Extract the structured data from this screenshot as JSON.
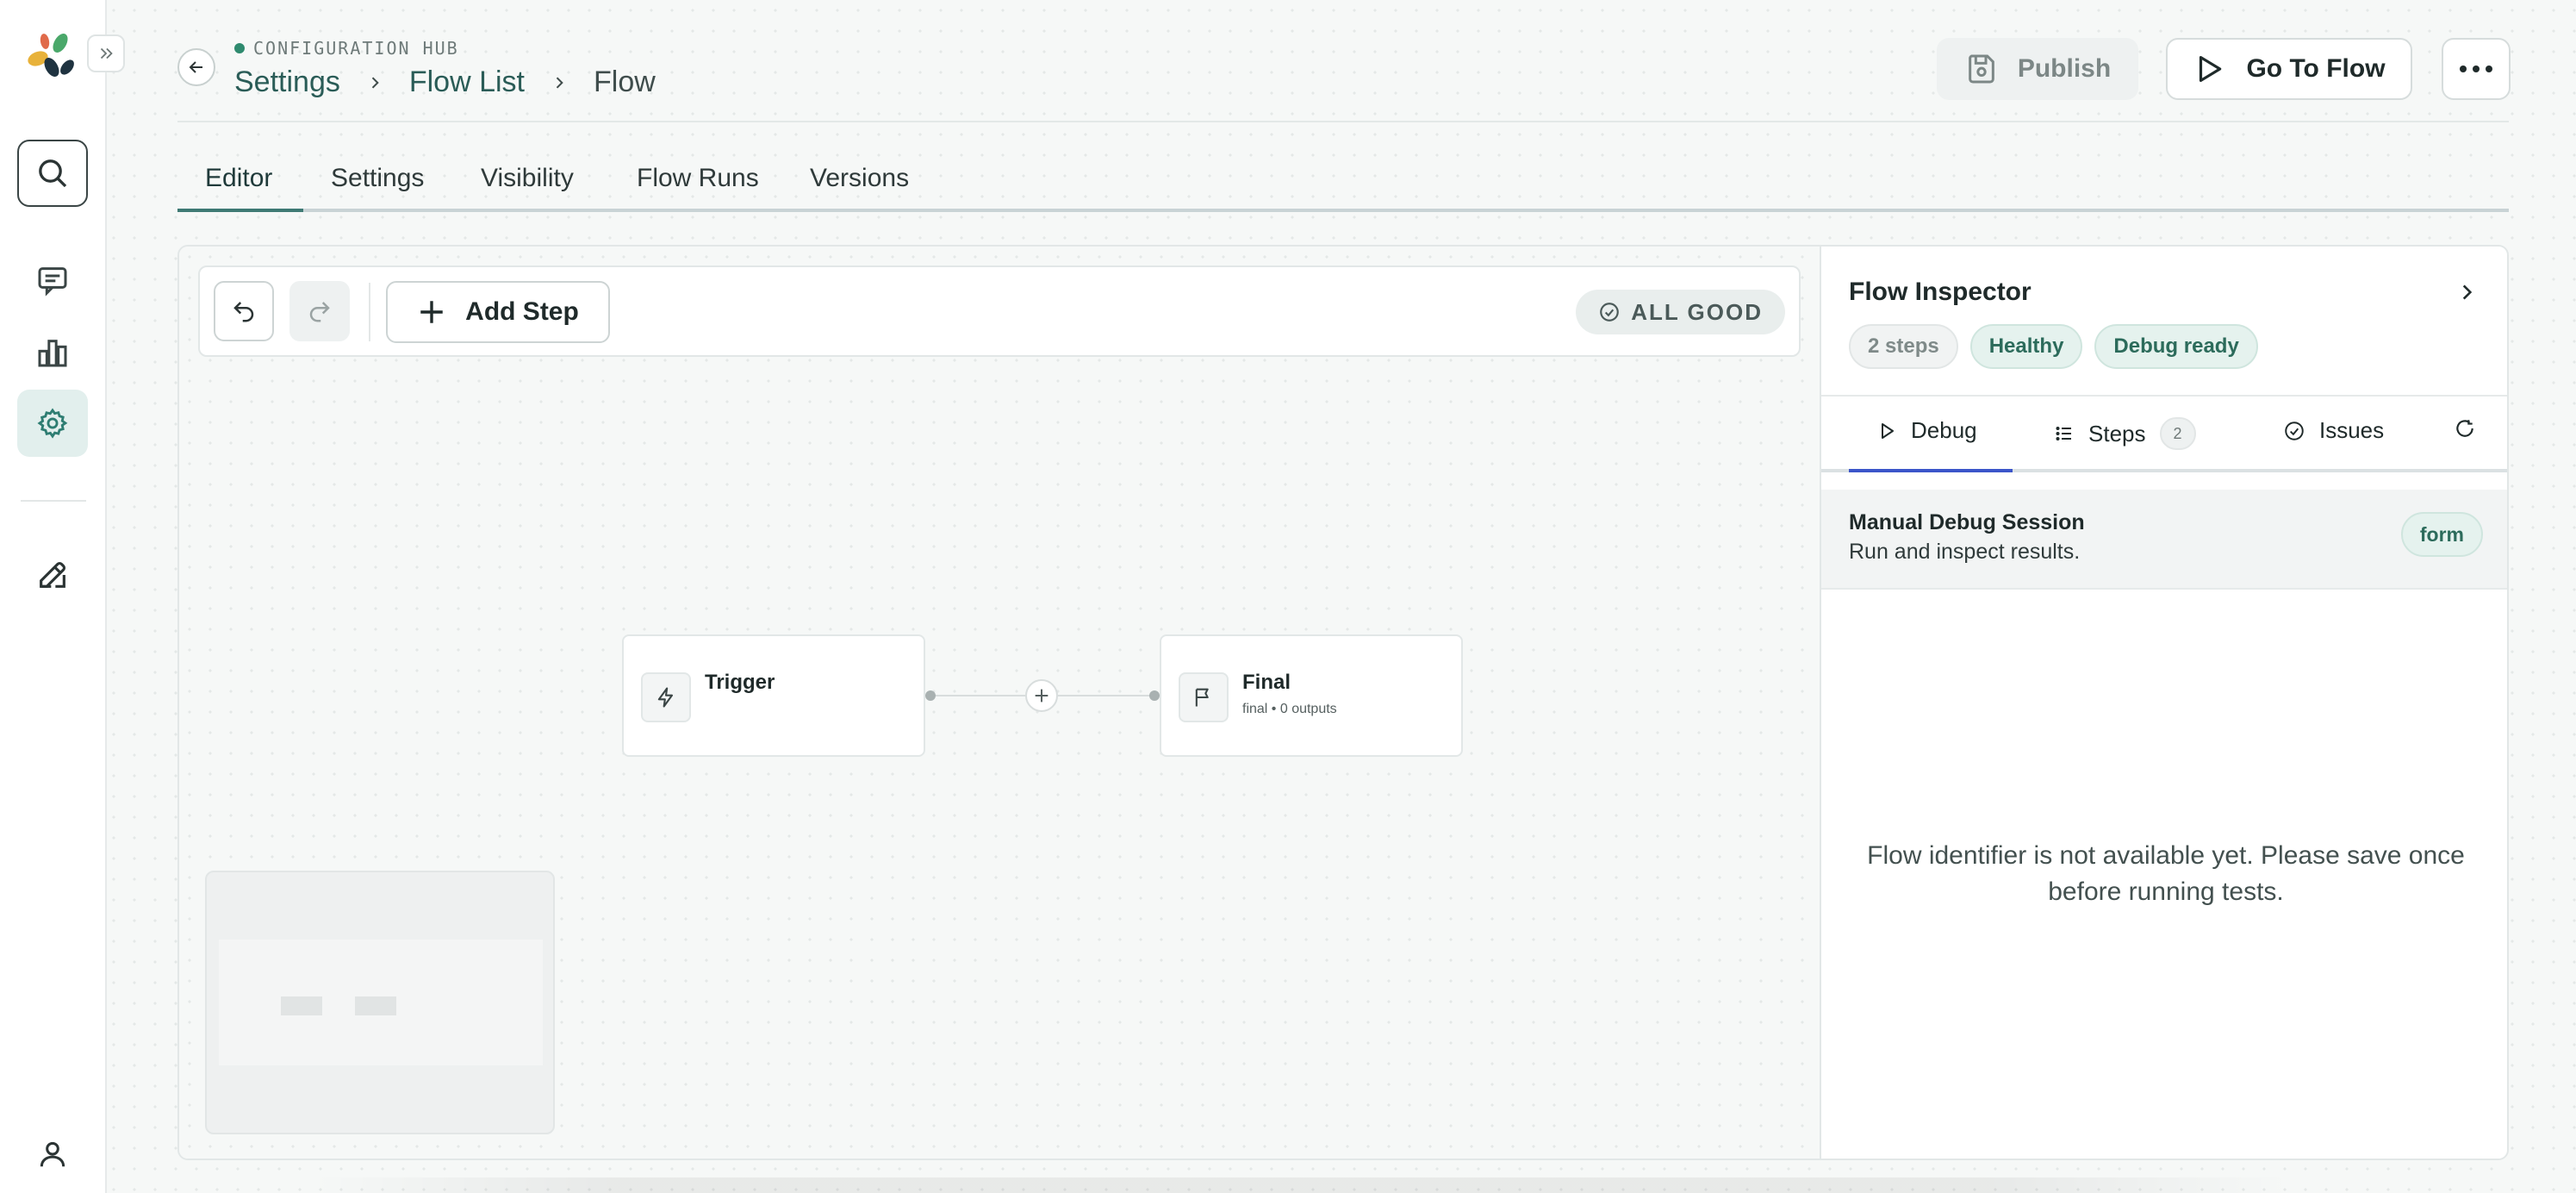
{
  "colors": {
    "accent": "#3e7a74",
    "active_tab_underline": "#3b55c9",
    "status_green": "#2e8a6e",
    "pill_green_bg": "#e5f2ee"
  },
  "rail": {
    "items": [
      {
        "icon": "search-icon"
      },
      {
        "icon": "chat-icon"
      },
      {
        "icon": "bar-chart-icon"
      },
      {
        "icon": "gear-icon",
        "active": true
      },
      {
        "icon": "edit-icon"
      },
      {
        "icon": "user-icon"
      }
    ]
  },
  "header": {
    "hub_label": "CONFIGURATION HUB",
    "breadcrumb": [
      {
        "label": "Settings"
      },
      {
        "label": "Flow List"
      },
      {
        "label": "Flow"
      }
    ],
    "publish_label": "Publish",
    "goto_label": "Go To Flow"
  },
  "tabs": [
    {
      "label": "Editor",
      "active": true
    },
    {
      "label": "Settings"
    },
    {
      "label": "Visibility"
    },
    {
      "label": "Flow Runs"
    },
    {
      "label": "Versions"
    }
  ],
  "toolbar": {
    "add_step_label": "Add Step",
    "status_label": "ALL GOOD"
  },
  "nodes": [
    {
      "title": "Trigger",
      "subtitle": "",
      "icon": "lightning-icon"
    },
    {
      "title": "Final",
      "subtitle": "final • 0 outputs",
      "icon": "flag-icon"
    }
  ],
  "inspector": {
    "title": "Flow Inspector",
    "pills": [
      "2 steps",
      "Healthy",
      "Debug ready"
    ],
    "tabs": [
      {
        "label": "Debug",
        "icon": "play-icon",
        "active": true
      },
      {
        "label": "Steps",
        "icon": "list-icon",
        "count": "2"
      },
      {
        "label": "Issues",
        "icon": "check-circle-icon"
      }
    ],
    "session": {
      "title": "Manual Debug Session",
      "subtitle": "Run and inspect results.",
      "badge": "form"
    },
    "empty_message": "Flow identifier is not available yet. Please save once before running tests."
  }
}
